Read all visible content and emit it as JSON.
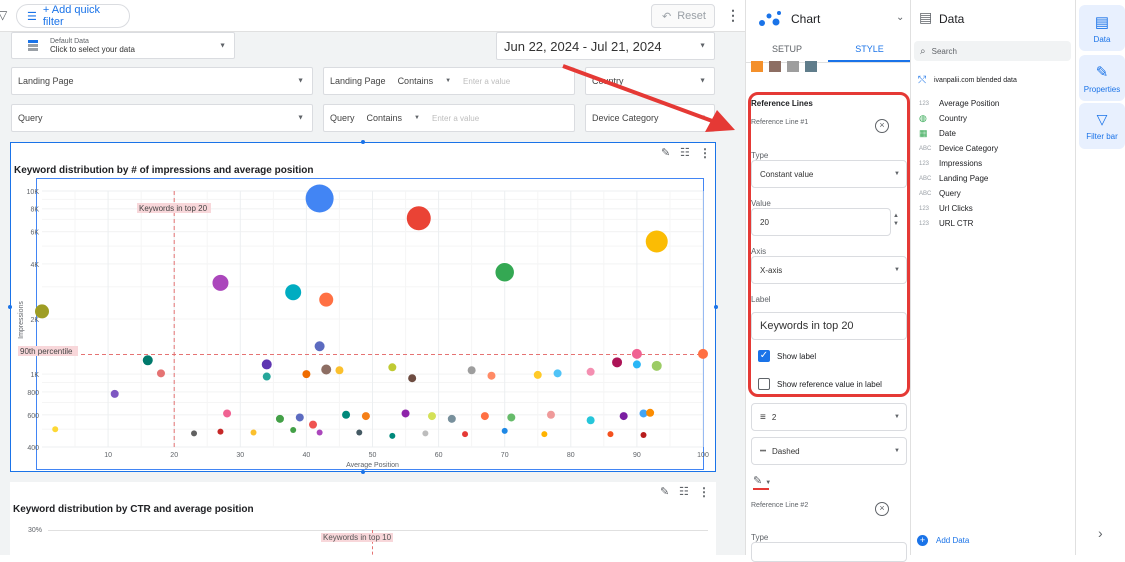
{
  "toolbar": {
    "add_filter": "+ Add quick filter",
    "reset": "Reset"
  },
  "controls": {
    "data_source_label": "Default Data",
    "data_source_hint": "Click to select your data",
    "date_range": "Jun 22, 2024 - Jul 21, 2024",
    "landing_page": "Landing Page",
    "landing_page_filter_field": "Landing Page",
    "landing_page_filter_op": "Contains",
    "landing_page_filter_placeholder": "Enter a value",
    "country": "Country",
    "query": "Query",
    "query_filter_field": "Query",
    "query_filter_op": "Contains",
    "query_filter_placeholder": "Enter a value",
    "device_category": "Device Category"
  },
  "chart1": {
    "title": "Keyword distribution by # of impressions and average position",
    "x_label": "Average Position",
    "y_label": "Impressions",
    "ref_x_label": "Keywords in top 20",
    "ref_y_label": "90th percentile",
    "x_ticks": [
      "10",
      "20",
      "30",
      "40",
      "50",
      "60",
      "70",
      "80",
      "90",
      "100"
    ],
    "y_ticks": [
      "10K",
      "8K",
      "6K",
      "4K",
      "2K",
      "1K",
      "800",
      "600",
      "400"
    ]
  },
  "chart2": {
    "title": "Keyword distribution by CTR and average position",
    "y_tick": "30%",
    "ref_x_label": "Keywords in top 10"
  },
  "chart_data": {
    "type": "scatter",
    "title": "Keyword distribution by # of impressions and average position",
    "xlabel": "Average Position",
    "ylabel": "Impressions",
    "x_range": [
      0,
      100
    ],
    "y_scale": "log",
    "y_range": [
      400,
      10000
    ],
    "reference_lines": [
      {
        "axis": "x",
        "value": 20,
        "label": "Keywords in top 20"
      },
      {
        "axis": "y",
        "value": 1280,
        "label": "90th percentile"
      }
    ],
    "points": [
      {
        "x": 42,
        "y": 9100,
        "r": 14,
        "color": "#4285f4"
      },
      {
        "x": 57,
        "y": 7100,
        "r": 12,
        "color": "#ea4335"
      },
      {
        "x": 93,
        "y": 5300,
        "r": 11,
        "color": "#fbbc04"
      },
      {
        "x": 70,
        "y": 3600,
        "r": 10,
        "color": "#34a853"
      },
      {
        "x": 27,
        "y": 3150,
        "r": 8,
        "color": "#ab47bc"
      },
      {
        "x": 38,
        "y": 2800,
        "r": 8,
        "color": "#00acc1"
      },
      {
        "x": 43,
        "y": 2550,
        "r": 7,
        "color": "#ff7043"
      },
      {
        "x": 0,
        "y": 2200,
        "r": 7,
        "color": "#9e9d24"
      },
      {
        "x": 42,
        "y": 1420,
        "r": 5,
        "color": "#5c6bc0"
      },
      {
        "x": 100,
        "y": 1290,
        "r": 5,
        "color": "#ff7043"
      },
      {
        "x": 90,
        "y": 1290,
        "r": 5,
        "color": "#f06292"
      },
      {
        "x": 16,
        "y": 1190,
        "r": 5,
        "color": "#00796b"
      },
      {
        "x": 18,
        "y": 1010,
        "r": 4,
        "color": "#e57373"
      },
      {
        "x": 11,
        "y": 780,
        "r": 4,
        "color": "#7e57c2"
      },
      {
        "x": 34,
        "y": 1130,
        "r": 5,
        "color": "#5e35b1"
      },
      {
        "x": 34,
        "y": 970,
        "r": 4,
        "color": "#26a69a"
      },
      {
        "x": 40,
        "y": 1000,
        "r": 4,
        "color": "#ef6c00"
      },
      {
        "x": 43,
        "y": 1060,
        "r": 5,
        "color": "#8d6e63"
      },
      {
        "x": 45,
        "y": 1050,
        "r": 4,
        "color": "#fbc02d"
      },
      {
        "x": 53,
        "y": 1090,
        "r": 4,
        "color": "#c0ca33"
      },
      {
        "x": 56,
        "y": 950,
        "r": 4,
        "color": "#6d4c41"
      },
      {
        "x": 65,
        "y": 1050,
        "r": 4,
        "color": "#9e9e9e"
      },
      {
        "x": 68,
        "y": 980,
        "r": 4,
        "color": "#ff8a65"
      },
      {
        "x": 75,
        "y": 990,
        "r": 4,
        "color": "#ffca28"
      },
      {
        "x": 78,
        "y": 1010,
        "r": 4,
        "color": "#4fc3f7"
      },
      {
        "x": 83,
        "y": 1030,
        "r": 4,
        "color": "#f48fb1"
      },
      {
        "x": 87,
        "y": 1160,
        "r": 5,
        "color": "#ad1457"
      },
      {
        "x": 90,
        "y": 1130,
        "r": 4,
        "color": "#29b6f6"
      },
      {
        "x": 93,
        "y": 1110,
        "r": 5,
        "color": "#9ccc65"
      },
      {
        "x": 28,
        "y": 610,
        "r": 4,
        "color": "#f06292"
      },
      {
        "x": 36,
        "y": 570,
        "r": 4,
        "color": "#43a047"
      },
      {
        "x": 39,
        "y": 580,
        "r": 4,
        "color": "#5c6bc0"
      },
      {
        "x": 41,
        "y": 530,
        "r": 4,
        "color": "#ef5350"
      },
      {
        "x": 46,
        "y": 600,
        "r": 4,
        "color": "#00897b"
      },
      {
        "x": 49,
        "y": 590,
        "r": 4,
        "color": "#f57f17"
      },
      {
        "x": 55,
        "y": 610,
        "r": 4,
        "color": "#8e24aa"
      },
      {
        "x": 59,
        "y": 590,
        "r": 4,
        "color": "#d4e157"
      },
      {
        "x": 62,
        "y": 570,
        "r": 4,
        "color": "#78909c"
      },
      {
        "x": 67,
        "y": 590,
        "r": 4,
        "color": "#ff7043"
      },
      {
        "x": 71,
        "y": 580,
        "r": 4,
        "color": "#66bb6a"
      },
      {
        "x": 77,
        "y": 600,
        "r": 4,
        "color": "#ef9a9a"
      },
      {
        "x": 83,
        "y": 560,
        "r": 4,
        "color": "#26c6da"
      },
      {
        "x": 88,
        "y": 590,
        "r": 4,
        "color": "#7b1fa2"
      },
      {
        "x": 91,
        "y": 610,
        "r": 4,
        "color": "#42a5f5"
      },
      {
        "x": 92,
        "y": 615,
        "r": 4,
        "color": "#fb8c00"
      },
      {
        "x": 2,
        "y": 500,
        "r": 3,
        "color": "#fdd835"
      },
      {
        "x": 23,
        "y": 475,
        "r": 3,
        "color": "#616161"
      },
      {
        "x": 27,
        "y": 485,
        "r": 3,
        "color": "#c62828"
      },
      {
        "x": 32,
        "y": 480,
        "r": 3,
        "color": "#fbc02d"
      },
      {
        "x": 38,
        "y": 495,
        "r": 3,
        "color": "#43a047"
      },
      {
        "x": 42,
        "y": 480,
        "r": 3,
        "color": "#ab47bc"
      },
      {
        "x": 48,
        "y": 480,
        "r": 3,
        "color": "#455a64"
      },
      {
        "x": 53,
        "y": 460,
        "r": 3,
        "color": "#00897b"
      },
      {
        "x": 58,
        "y": 475,
        "r": 3,
        "color": "#bdbdbd"
      },
      {
        "x": 64,
        "y": 470,
        "r": 3,
        "color": "#e53935"
      },
      {
        "x": 70,
        "y": 490,
        "r": 3,
        "color": "#1e88e5"
      },
      {
        "x": 76,
        "y": 470,
        "r": 3,
        "color": "#ffb300"
      },
      {
        "x": 86,
        "y": 470,
        "r": 3,
        "color": "#f4511e"
      },
      {
        "x": 91,
        "y": 465,
        "r": 3,
        "color": "#b71c1c"
      }
    ]
  },
  "style_panel": {
    "header": "Chart",
    "tab_setup": "SETUP",
    "tab_style": "STYLE",
    "swatches": [
      "#f4902b",
      "#8d6e63",
      "#9e9e9e",
      "#607d8b"
    ],
    "section_title": "Reference Lines",
    "ref1_title": "Reference Line #1",
    "type_label": "Type",
    "type_value": "Constant value",
    "value_label": "Value",
    "value_value": "20",
    "axis_label": "Axis",
    "axis_value": "X-axis",
    "label_label": "Label",
    "label_value": "Keywords in top 20",
    "show_label": "Show label",
    "show_ref_value": "Show reference value in label",
    "line_weight": "2",
    "line_style": "Dashed",
    "ref2_title": "Reference Line #2",
    "type2_label": "Type"
  },
  "data_panel": {
    "header": "Data",
    "search_placeholder": "Search",
    "source": "ivanpalii.com blended data",
    "fields": [
      {
        "type": "123",
        "name": "Average Position"
      },
      {
        "type": "geo",
        "name": "Country"
      },
      {
        "type": "date",
        "name": "Date"
      },
      {
        "type": "ABC",
        "name": "Device Category"
      },
      {
        "type": "123",
        "name": "Impressions"
      },
      {
        "type": "ABC",
        "name": "Landing Page"
      },
      {
        "type": "ABC",
        "name": "Query"
      },
      {
        "type": "123",
        "name": "Url Clicks"
      },
      {
        "type": "123",
        "name": "URL CTR"
      }
    ],
    "add_data": "Add Data"
  },
  "rail": {
    "data": "Data",
    "properties": "Properties",
    "filter_bar": "Filter bar"
  }
}
